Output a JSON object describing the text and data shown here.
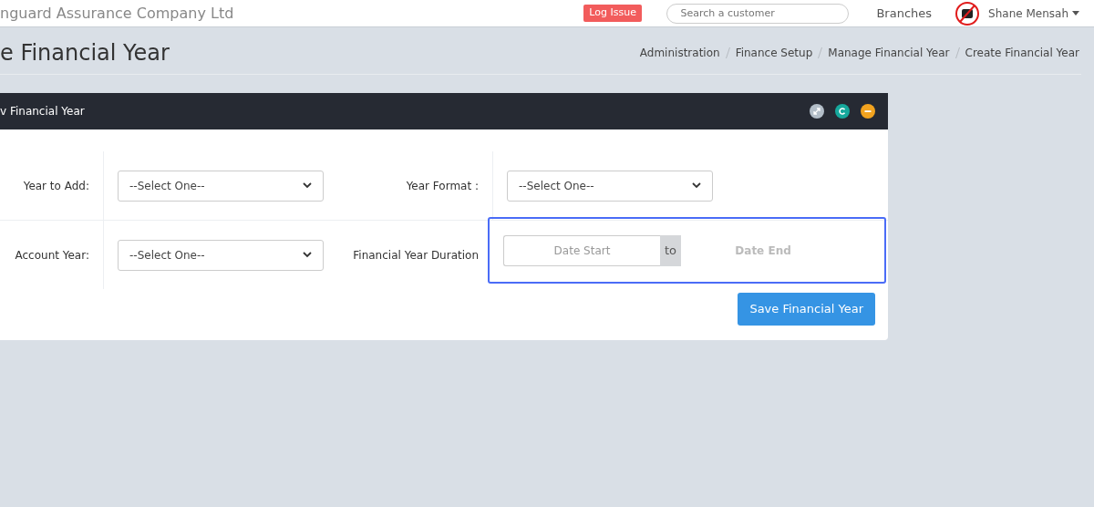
{
  "navbar": {
    "company": "nguard Assurance Company Ltd",
    "log_issue": "Log Issue",
    "search": {
      "placeholder": "Search a customer"
    },
    "branches": "Branches",
    "user": "Shane Mensah"
  },
  "page_title": "e Financial Year",
  "breadcrumb": [
    "Administration",
    "Finance Setup",
    "Manage Financial Year",
    "Create Financial Year"
  ],
  "card": {
    "title": "v Financial Year",
    "tools": [
      {
        "kind": "expand",
        "color": "#b3bec8"
      },
      {
        "kind": "refresh",
        "color": "#16a89c"
      },
      {
        "kind": "collapse",
        "color": "#f2a31f"
      }
    ],
    "rows": [
      [
        {
          "label": "Year to Add:",
          "kind": "select",
          "value": "--Select One--"
        },
        {
          "label": "Year Format :",
          "kind": "select",
          "value": "--Select One--"
        }
      ],
      [
        {
          "label": "Account Year:",
          "kind": "select",
          "value": "--Select One--"
        },
        {
          "label": "Financial Year Duration",
          "kind": "daterange",
          "start_placeholder": "Date Start",
          "separator": "to",
          "end_placeholder": "Date End",
          "focused": true
        }
      ]
    ],
    "save_button": "Save Financial Year"
  }
}
